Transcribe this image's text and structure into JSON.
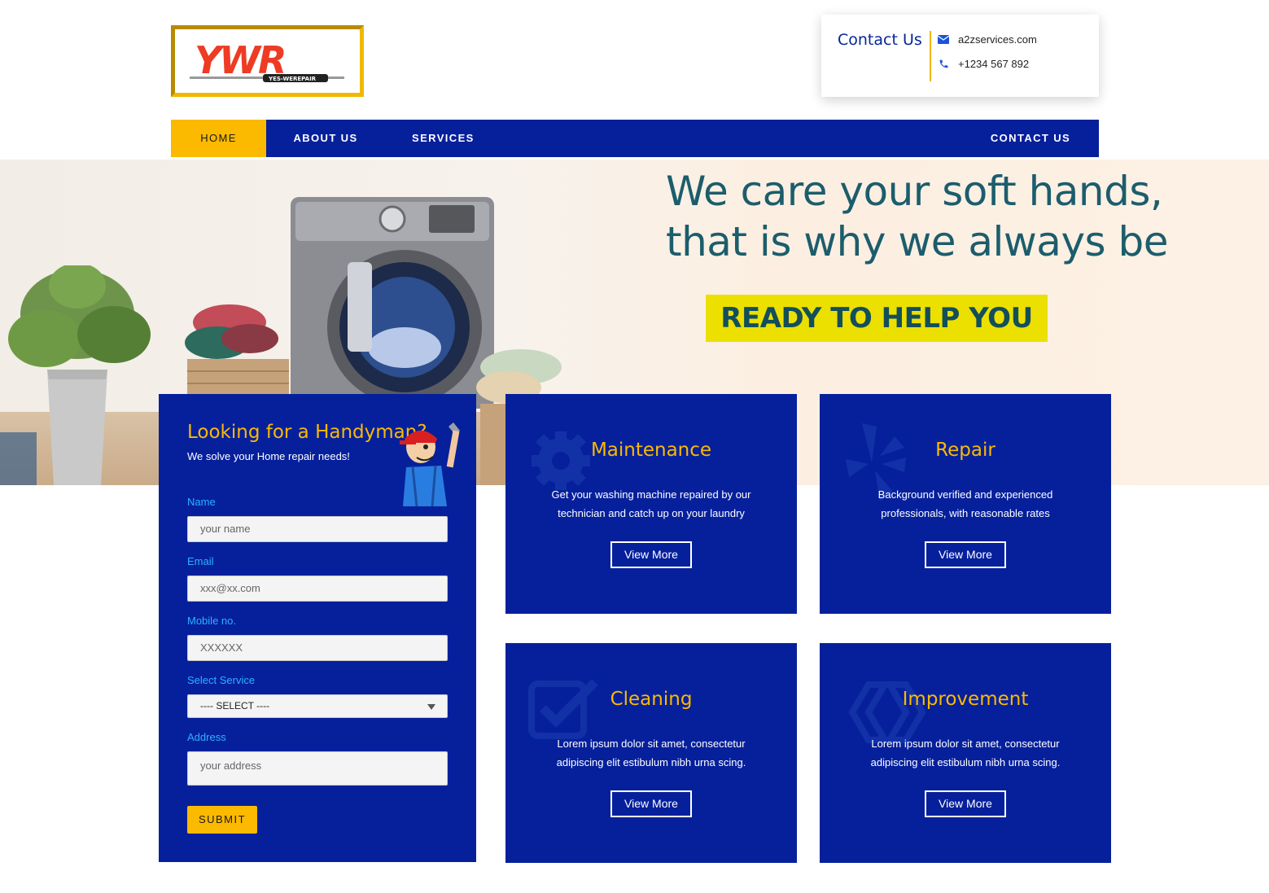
{
  "logo": {
    "text": "YWR",
    "tagline": "YES-WEREPAIR"
  },
  "contact": {
    "title": "Contact Us",
    "email": "a2zservices.com",
    "phone": "+1234 567 892",
    "email_icon": "envelope-icon",
    "phone_icon": "phone-icon"
  },
  "nav": {
    "items": [
      {
        "label": "HOME",
        "active": true
      },
      {
        "label": "ABOUT US",
        "active": false
      },
      {
        "label": "SERVICES",
        "active": false
      },
      {
        "label": "CONTACT US",
        "active": false
      }
    ]
  },
  "hero": {
    "headline_line1": "We care your soft hands,",
    "headline_line2": "that is why we always be",
    "cta": "READY TO HELP YOU"
  },
  "form": {
    "title": "Looking for a Handyman?",
    "subtitle": "We solve your Home repair needs!",
    "fields": {
      "name": {
        "label": "Name",
        "placeholder": "your name"
      },
      "email": {
        "label": "Email",
        "placeholder": "xxx@xx.com"
      },
      "mobile": {
        "label": "Mobile no.",
        "placeholder": "XXXXXX"
      },
      "service": {
        "label": "Select Service",
        "value": "---- SELECT ----"
      },
      "address": {
        "label": "Address",
        "placeholder": "your address"
      }
    },
    "submit": "SUBMIT"
  },
  "services": [
    {
      "title": "Maintenance",
      "desc_line1": "Get your washing machine repaired by our",
      "desc_line2": "technician and catch up on your laundry",
      "button": "View More",
      "icon": "gear-icon"
    },
    {
      "title": "Repair",
      "desc_line1": "Background verified and experienced",
      "desc_line2": "professionals, with reasonable rates",
      "button": "View More",
      "icon": "yelp-icon"
    },
    {
      "title": "Cleaning",
      "desc_line1": "Lorem ipsum dolor sit amet, consectetur",
      "desc_line2": "adipiscing elit estibulum nibh urna scing.",
      "button": "View More",
      "icon": "checkbox-icon"
    },
    {
      "title": "Improvement",
      "desc_line1": "Lorem ipsum dolor sit amet, consectetur",
      "desc_line2": "adipiscing elit estibulum nibh urna scing.",
      "button": "View More",
      "icon": "hexagon-icon"
    }
  ],
  "colors": {
    "primary": "#06209c",
    "accent": "#fbb900",
    "label": "#2cb2ff",
    "hero_text": "#1c5d6c",
    "hero_cta_bg": "#ece000"
  }
}
